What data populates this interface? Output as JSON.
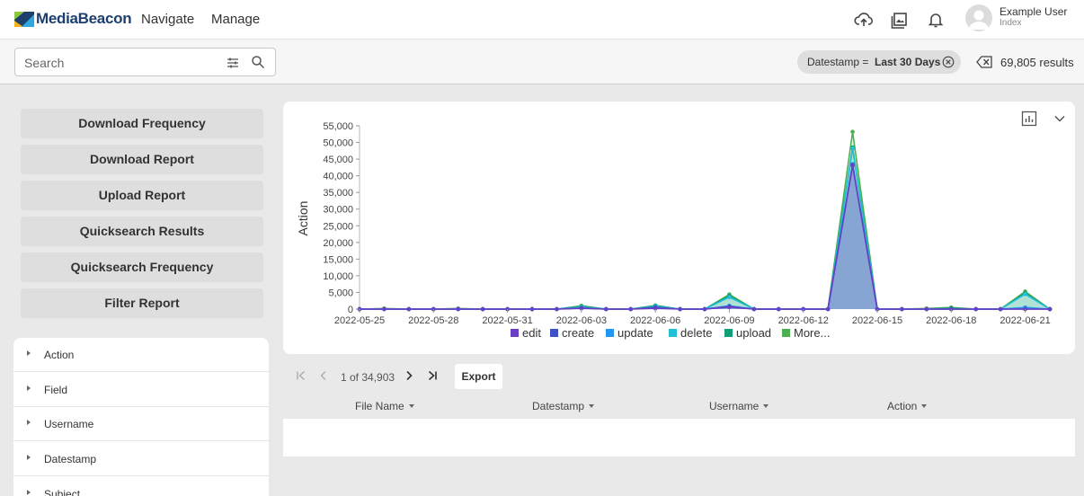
{
  "app": {
    "logo_text": "MediaBeacon",
    "nav": [
      "Navigate",
      "Manage"
    ],
    "user": {
      "name": "Example User",
      "subtitle": "Index"
    }
  },
  "search": {
    "placeholder": "Search",
    "filter_chip": {
      "label": "Datestamp =",
      "value": "Last 30 Days"
    },
    "results": "69,805 results"
  },
  "sidebar": {
    "reports": [
      "Download Frequency",
      "Download Report",
      "Upload Report",
      "Quicksearch Results",
      "Quicksearch Frequency",
      "Filter Report"
    ],
    "facets": [
      "Action",
      "Field",
      "Username",
      "Datestamp",
      "Subject"
    ]
  },
  "chart_data": {
    "type": "area",
    "ylabel": "Action",
    "ylim": [
      0,
      55000
    ],
    "yticks": [
      "0",
      "5,000",
      "10,000",
      "15,000",
      "20,000",
      "25,000",
      "30,000",
      "35,000",
      "40,000",
      "45,000",
      "50,000",
      "55,000"
    ],
    "x": [
      "2022-05-25",
      "2022-05-26",
      "2022-05-27",
      "2022-05-28",
      "2022-05-29",
      "2022-05-30",
      "2022-05-31",
      "2022-06-01",
      "2022-06-02",
      "2022-06-03",
      "2022-06-04",
      "2022-06-05",
      "2022-06-06",
      "2022-06-07",
      "2022-06-08",
      "2022-06-09",
      "2022-06-10",
      "2022-06-11",
      "2022-06-12",
      "2022-06-13",
      "2022-06-14",
      "2022-06-15",
      "2022-06-16",
      "2022-06-17",
      "2022-06-18",
      "2022-06-19",
      "2022-06-20",
      "2022-06-21",
      "2022-06-22"
    ],
    "xticks": [
      "2022-05-25",
      "2022-05-28",
      "2022-05-31",
      "2022-06-03",
      "2022-06-06",
      "2022-06-09",
      "2022-06-12",
      "2022-06-15",
      "2022-06-18",
      "2022-06-21"
    ],
    "series": [
      {
        "name": "edit",
        "color": "#6a3fc6",
        "values": [
          0,
          0,
          0,
          0,
          0,
          0,
          0,
          0,
          0,
          200,
          0,
          0,
          200,
          0,
          0,
          600,
          0,
          0,
          0,
          0,
          43000,
          0,
          0,
          0,
          0,
          0,
          0,
          0,
          0
        ]
      },
      {
        "name": "create",
        "color": "#3f51c6",
        "values": [
          0,
          0,
          0,
          0,
          0,
          0,
          0,
          0,
          0,
          100,
          0,
          0,
          300,
          0,
          0,
          200,
          0,
          0,
          0,
          0,
          300,
          0,
          0,
          0,
          0,
          0,
          0,
          0,
          0
        ]
      },
      {
        "name": "update",
        "color": "#2196f3",
        "values": [
          0,
          0,
          0,
          0,
          0,
          0,
          0,
          0,
          0,
          100,
          0,
          0,
          100,
          0,
          0,
          200,
          0,
          0,
          0,
          0,
          200,
          0,
          0,
          0,
          0,
          0,
          0,
          500,
          0
        ]
      },
      {
        "name": "delete",
        "color": "#22bfd6",
        "values": [
          0,
          0,
          0,
          0,
          0,
          0,
          0,
          0,
          0,
          200,
          0,
          0,
          200,
          0,
          0,
          2600,
          0,
          0,
          0,
          0,
          4700,
          0,
          0,
          0,
          0,
          0,
          0,
          4000,
          0
        ]
      },
      {
        "name": "upload",
        "color": "#0f9d7a",
        "values": [
          0,
          0,
          0,
          0,
          0,
          0,
          0,
          0,
          0,
          200,
          0,
          0,
          200,
          0,
          0,
          400,
          0,
          0,
          0,
          0,
          300,
          0,
          0,
          0,
          300,
          0,
          0,
          300,
          0
        ]
      },
      {
        "name": "More...",
        "color": "#4caf50",
        "values": [
          0,
          200,
          0,
          0,
          200,
          0,
          0,
          0,
          0,
          200,
          0,
          0,
          100,
          0,
          0,
          400,
          0,
          0,
          0,
          0,
          4700,
          0,
          0,
          200,
          200,
          0,
          0,
          500,
          0
        ]
      }
    ]
  },
  "table": {
    "pager_text": "1 of 34,903",
    "export_label": "Export",
    "columns": [
      "File Name",
      "Datestamp",
      "Username",
      "Action"
    ]
  }
}
